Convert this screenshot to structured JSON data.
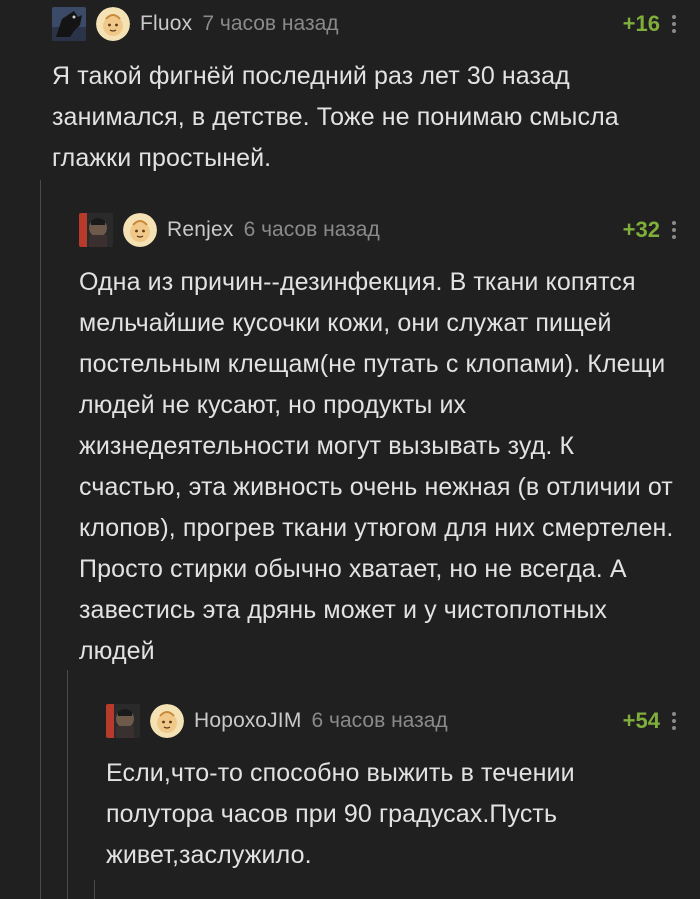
{
  "comments": [
    {
      "username": "Fluox",
      "time": "7 часов назад",
      "rating": "+16",
      "text": "Я такой фигнёй последний раз лет 30 назад занимался, в детстве. Тоже не понимаю смысла глажки простыней."
    },
    {
      "username": "Renjex",
      "time": "6 часов назад",
      "rating": "+32",
      "text": "Одна из причин--дезинфекция. В ткани копятся мельчайшие кусочки кожи, они служат пищей постельным клещам(не путать с клопами). Клещи людей не кусают, но продукты их жизнедеятельности могут вызывать зуд. К счастью, эта живность очень нежная (в отличии от клопов), прогрев ткани утюгом для них смертелен. Просто стирки обычно хватает, но не всегда. А завестись эта дрянь может и у чистоплотных людей"
    },
    {
      "username": "НорохоJIM",
      "time": "6 часов назад",
      "rating": "+54",
      "text": "Если,что-то способно выжить в течении полутора часов при 90 градусах.Пусть живет,заслужило."
    }
  ]
}
